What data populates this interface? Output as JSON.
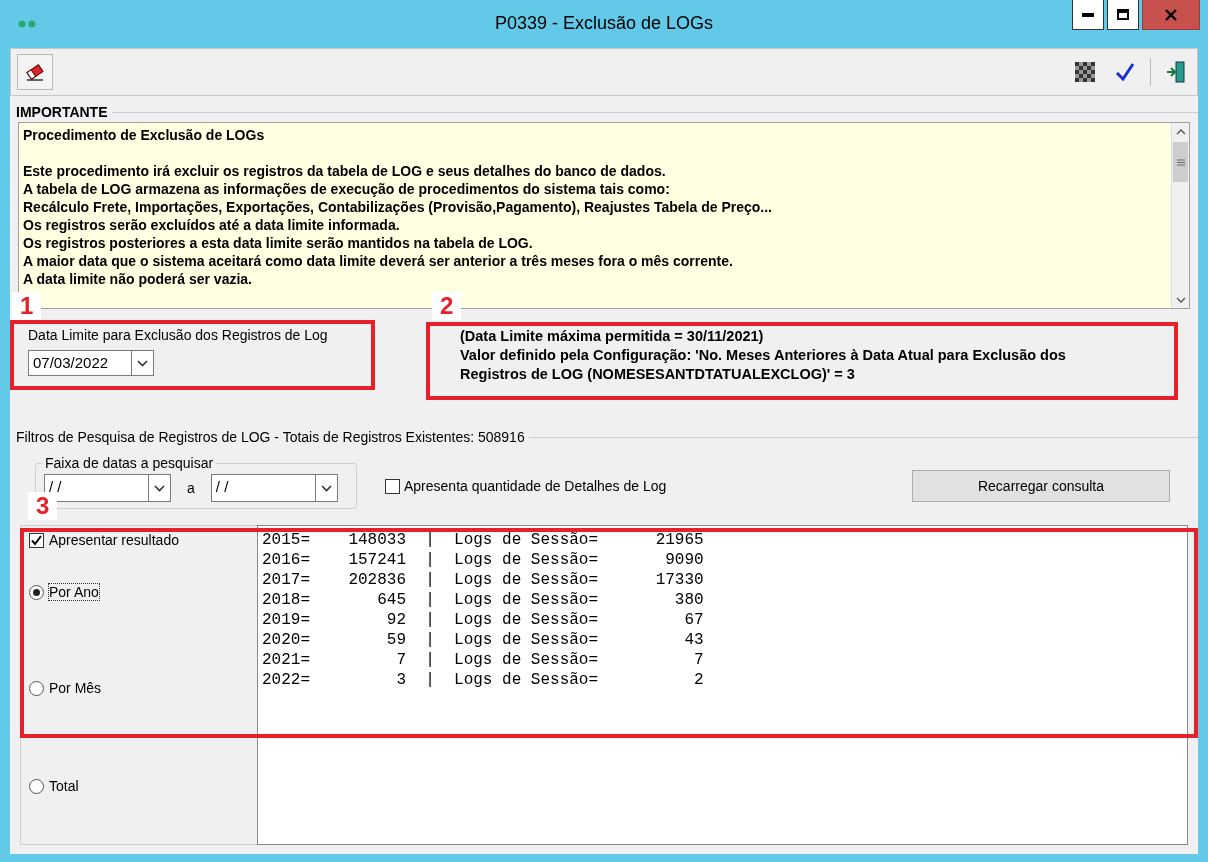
{
  "window": {
    "title": "P0339 - Exclusão de LOGs"
  },
  "important": {
    "title": "IMPORTANTE",
    "heading": "Procedimento de Exclusão de LOGs",
    "lines": [
      "Este procedimento irá excluir os registros da tabela de LOG e seus detalhes do banco de dados.",
      "A tabela de LOG armazena as informações de execução de procedimentos do sistema tais como:",
      "Recálculo Frete, Importações, Exportações, Contabilizações (Provisão,Pagamento), Reajustes Tabela de Preço...",
      "Os registros serão excluídos até a data limite informada.",
      "Os registros posteriores a esta data limite serão mantidos na tabela de LOG.",
      "A maior data que o sistema aceitará como data limite deverá ser anterior a três meses fora o mês corrente.",
      "A data limite não poderá ser vazia."
    ]
  },
  "date_limit": {
    "label": "Data Limite para Exclusão dos Registros de Log",
    "value": "07/03/2022"
  },
  "info_lines": [
    "(Data Limite máxima permitida = 30/11/2021)",
    "Valor definido pela Configuração: 'No. Meses Anteriores à Data Atual para Exclusão dos",
    "Registros de LOG (NOMESESANTDTATUALEXCLOG)' = 3"
  ],
  "filters": {
    "title": "Filtros de Pesquisa de Registros de LOG - Totais de Registros Existentes: 508916",
    "range": {
      "title": "Faixa de datas a pesquisar",
      "from": "/ /",
      "separator": "a",
      "to": "/ /"
    },
    "details_checkbox": {
      "label": "Apresenta quantidade de Detalhes de Log",
      "checked": false
    },
    "reload_button": "Recarregar consulta"
  },
  "result_checkbox": {
    "label": "Apresentar resultado",
    "checked": true
  },
  "grouping": [
    {
      "label": "Por Ano",
      "selected": true
    },
    {
      "label": "Por Mês",
      "selected": false
    },
    {
      "label": "Total",
      "selected": false
    }
  ],
  "results": [
    "2015=    148033  |  Logs de Sessão=      21965",
    "2016=    157241  |  Logs de Sessão=       9090",
    "2017=    202836  |  Logs de Sessão=      17330",
    "2018=       645  |  Logs de Sessão=        380",
    "2019=        92  |  Logs de Sessão=         67",
    "2020=        59  |  Logs de Sessão=         43",
    "2021=         7  |  Logs de Sessão=          7",
    "2022=         3  |  Logs de Sessão=          2"
  ],
  "annotations": [
    {
      "label": "1"
    },
    {
      "label": "2"
    },
    {
      "label": "3"
    }
  ]
}
